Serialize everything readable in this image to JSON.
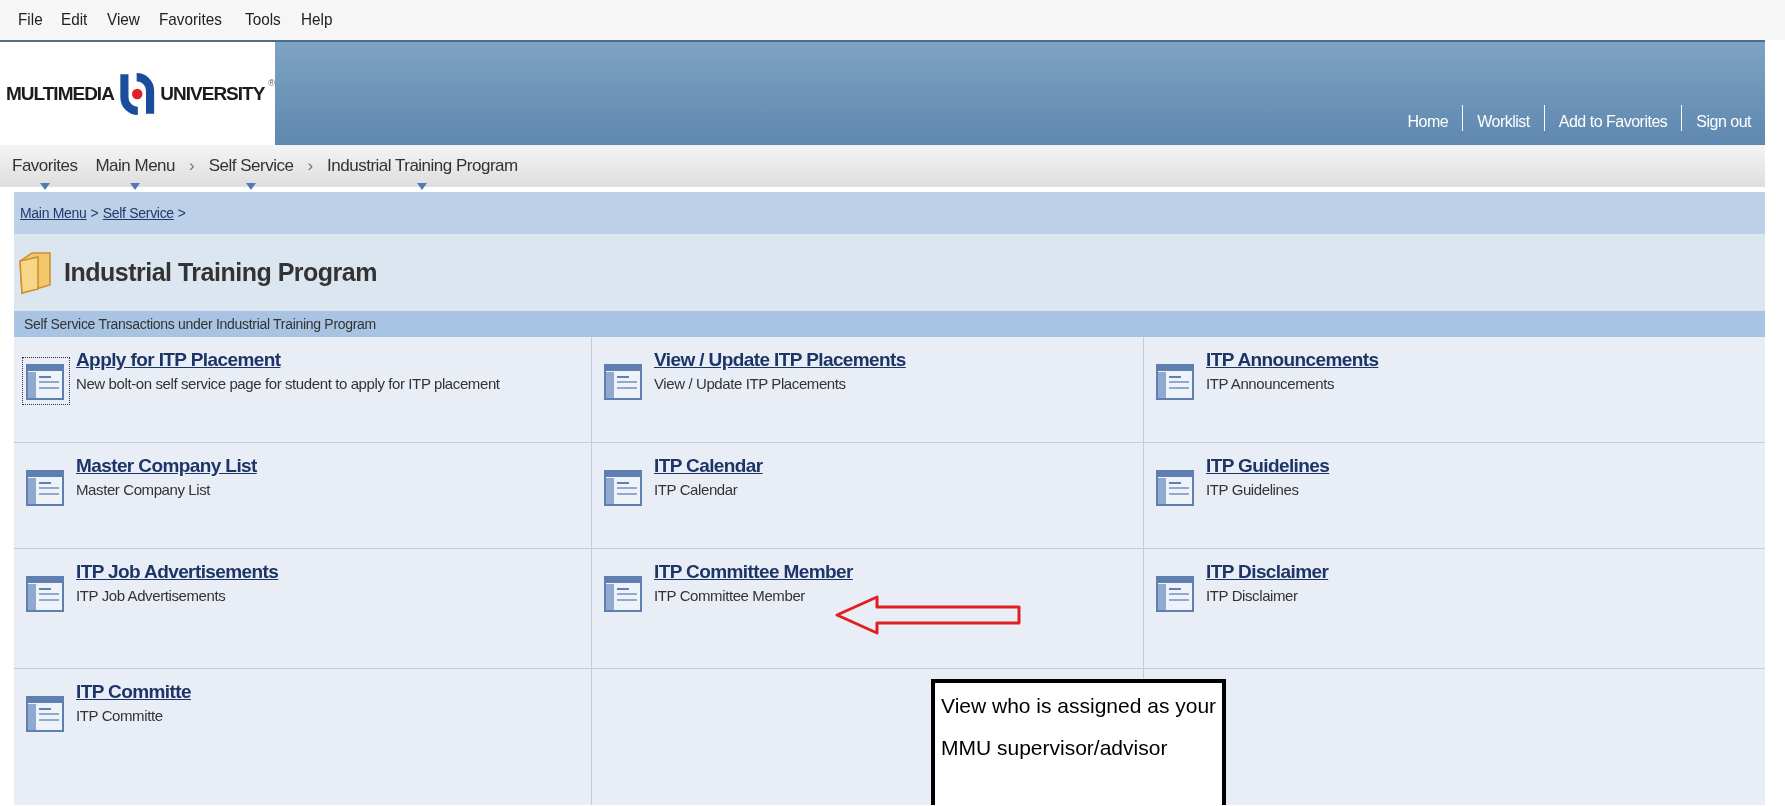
{
  "menu_bar": [
    "File",
    "Edit",
    "View",
    "Favorites",
    "Tools",
    "Help"
  ],
  "header": {
    "logo_left": "MULTIMEDIA",
    "logo_right": "UNIVERSITY",
    "logo_mark": "®",
    "links": [
      "Home",
      "Worklist",
      "Add to Favorites",
      "Sign out"
    ]
  },
  "nav": {
    "items": [
      {
        "label": "Favorites",
        "kind": "menu"
      },
      {
        "label": "Main Menu",
        "kind": "menu"
      },
      {
        "label": "›",
        "kind": "sep"
      },
      {
        "label": "Self Service",
        "kind": "menu"
      },
      {
        "label": "›",
        "kind": "sep"
      },
      {
        "label": "Industrial Training Program",
        "kind": "menu"
      }
    ]
  },
  "breadcrumb": [
    {
      "label": "Main Menu",
      "kind": "link"
    },
    {
      "label": ">",
      "kind": "sep"
    },
    {
      "label": "Self Service",
      "kind": "link"
    },
    {
      "label": ">",
      "kind": "sep"
    }
  ],
  "page_title": "Industrial Training Program",
  "subheader": "Self Service Transactions under Industrial Training Program",
  "tiles": [
    {
      "title": "Apply for ITP Placement",
      "description": "New bolt-on self service page for student to apply for ITP placement",
      "focused": true
    },
    {
      "title": "View / Update ITP Placements",
      "description": "View / Update ITP Placements",
      "focused": false
    },
    {
      "title": "ITP Announcements",
      "description": "ITP Announcements",
      "focused": false
    },
    {
      "title": "Master Company List",
      "description": "Master Company List",
      "focused": false
    },
    {
      "title": "ITP Calendar",
      "description": "ITP Calendar",
      "focused": false
    },
    {
      "title": "ITP Guidelines",
      "description": "ITP Guidelines",
      "focused": false
    },
    {
      "title": "ITP Job Advertisements",
      "description": "ITP Job Advertisements",
      "focused": false
    },
    {
      "title": "ITP Committee Member",
      "description": "ITP Committee Member",
      "focused": false
    },
    {
      "title": "ITP Disclaimer",
      "description": "ITP Disclaimer",
      "focused": false
    },
    {
      "title": "ITP Committe",
      "description": "ITP Committe",
      "focused": false
    }
  ],
  "annotation": {
    "lines": [
      "View who is assigned as your",
      "MMU supervisor/advisor"
    ]
  }
}
